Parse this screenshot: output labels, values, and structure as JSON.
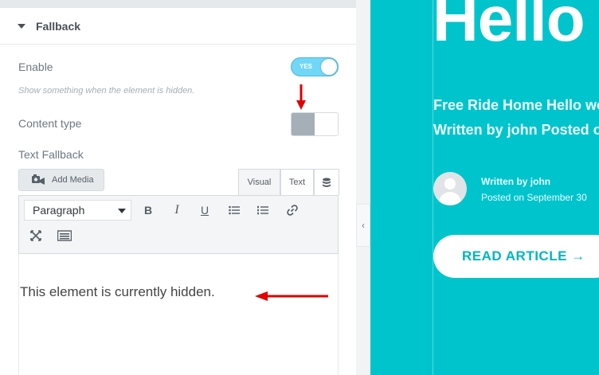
{
  "panel": {
    "section_title": "Fallback",
    "enable_label": "Enable",
    "enable_toggle_text": "YES",
    "enable_hint": "Show something when the element is hidden.",
    "content_type_label": "Content type",
    "text_fallback_label": "Text Fallback",
    "add_media_label": "Add Media",
    "tabs": {
      "visual": "Visual",
      "text": "Text"
    },
    "format_select_value": "Paragraph",
    "toolbar_icons": [
      "bold-icon",
      "italic-icon",
      "underline-icon",
      "bullet-list-icon",
      "numbered-list-icon",
      "link-icon",
      "fullscreen-icon",
      "keyboard-icon"
    ],
    "editor_content": "This element is currently hidden."
  },
  "preview": {
    "heading": "Hello",
    "subtitle_line1": "Free Ride Home Hello wo",
    "subtitle_line2": "Written by john Posted o",
    "author_line": "Written by john",
    "date_line": "Posted on September 30",
    "read_button": "READ ARTICLE"
  },
  "colors": {
    "accent_teal": "#00c4cc",
    "toggle_on": "#71d7f7",
    "annotation_red": "#e00000"
  }
}
